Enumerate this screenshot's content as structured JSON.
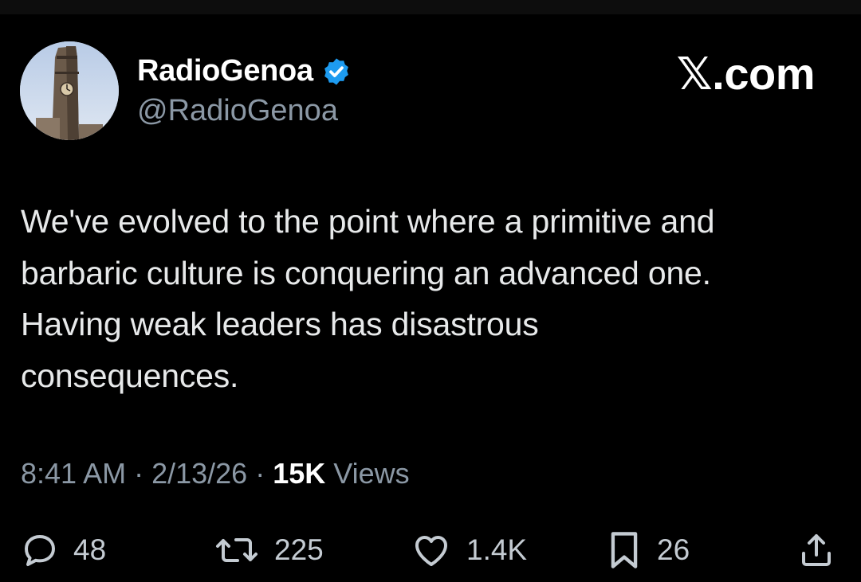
{
  "author": {
    "display_name": "RadioGenoa",
    "handle": "@RadioGenoa",
    "verified": true,
    "avatar_icon": "clock-tower-avatar"
  },
  "brand": {
    "label": "𝕏.com"
  },
  "tweet": {
    "text": "We've evolved to the point where a primitive and\nbarbaric culture is conquering an advanced one.\nHaving weak leaders has disastrous\nconsequences."
  },
  "meta": {
    "time": "8:41 AM",
    "sep1": " · ",
    "date": "2/13/26",
    "sep2": " · ",
    "views_count": "15K",
    "views_label": " Views"
  },
  "actions": {
    "replies": "48",
    "reposts": "225",
    "likes": "1.4K",
    "bookmarks": "26"
  },
  "colors": {
    "background": "#000000",
    "text_primary": "#e7e9ea",
    "text_secondary": "#8b98a5",
    "verified_badge": "#1d9bf0"
  }
}
